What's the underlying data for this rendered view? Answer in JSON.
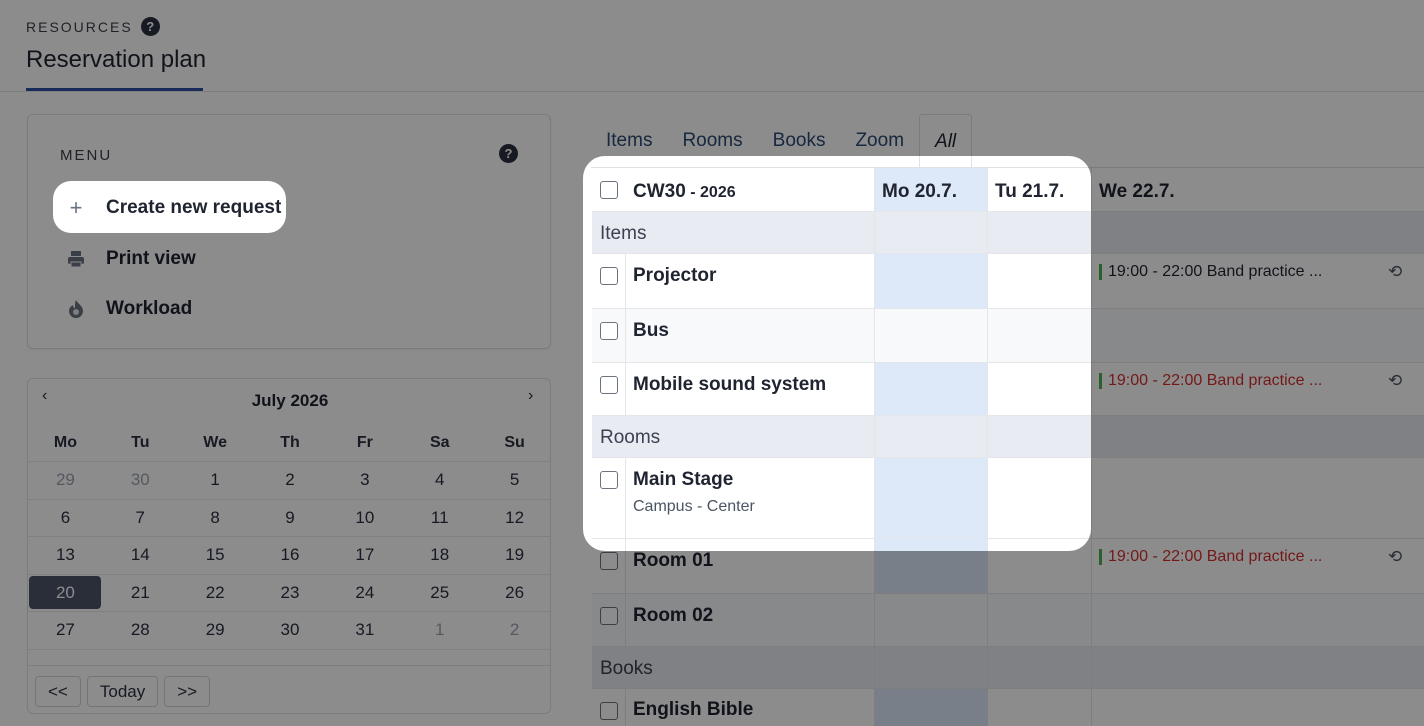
{
  "header": {
    "section_label": "RESOURCES",
    "help": "?",
    "title": "Reservation plan"
  },
  "menu": {
    "title": "MENU",
    "help": "?",
    "items": [
      {
        "label": "Create new request",
        "icon": "plus-icon"
      },
      {
        "label": "Print view",
        "icon": "printer-icon"
      },
      {
        "label": "Workload",
        "icon": "flame-icon"
      }
    ]
  },
  "calendar": {
    "prev": "‹",
    "next": "›",
    "month": "July 2026",
    "weekdays": [
      "Mo",
      "Tu",
      "We",
      "Th",
      "Fr",
      "Sa",
      "Su"
    ],
    "weeks": [
      [
        "29",
        "30",
        "1",
        "2",
        "3",
        "4",
        "5"
      ],
      [
        "6",
        "7",
        "8",
        "9",
        "10",
        "11",
        "12"
      ],
      [
        "13",
        "14",
        "15",
        "16",
        "17",
        "18",
        "19"
      ],
      [
        "20",
        "21",
        "22",
        "23",
        "24",
        "25",
        "26"
      ],
      [
        "27",
        "28",
        "29",
        "30",
        "31",
        "1",
        "2"
      ]
    ],
    "selected": "20",
    "footer": {
      "prev_month": "<<",
      "today": "Today",
      "next_month": ">>"
    }
  },
  "tabs": [
    {
      "label": "Items"
    },
    {
      "label": "Rooms"
    },
    {
      "label": "Books"
    },
    {
      "label": "Zoom"
    },
    {
      "label": "All",
      "active": true
    }
  ],
  "schedule": {
    "week_label": "CW30",
    "year_label": " - 2026",
    "days": [
      "Mo 20.7.",
      "Tu 21.7.",
      "We 22.7."
    ],
    "groups": {
      "items": "Items",
      "rooms": "Rooms",
      "books": "Books"
    },
    "resources": {
      "projector": "Projector",
      "bus": "Bus",
      "sound": "Mobile sound system",
      "main_stage": "Main Stage",
      "main_stage_sub": "Campus - Center",
      "room01": "Room 01",
      "room02": "Room 02",
      "bible": "English Bible"
    },
    "events": {
      "projector": "19:00 - 22:00 Band practice ...",
      "sound": "19:00 - 22:00 Band practice ...",
      "room01": "19:00 - 22:00 Band practice ..."
    },
    "repeat_icon": "⟲"
  }
}
